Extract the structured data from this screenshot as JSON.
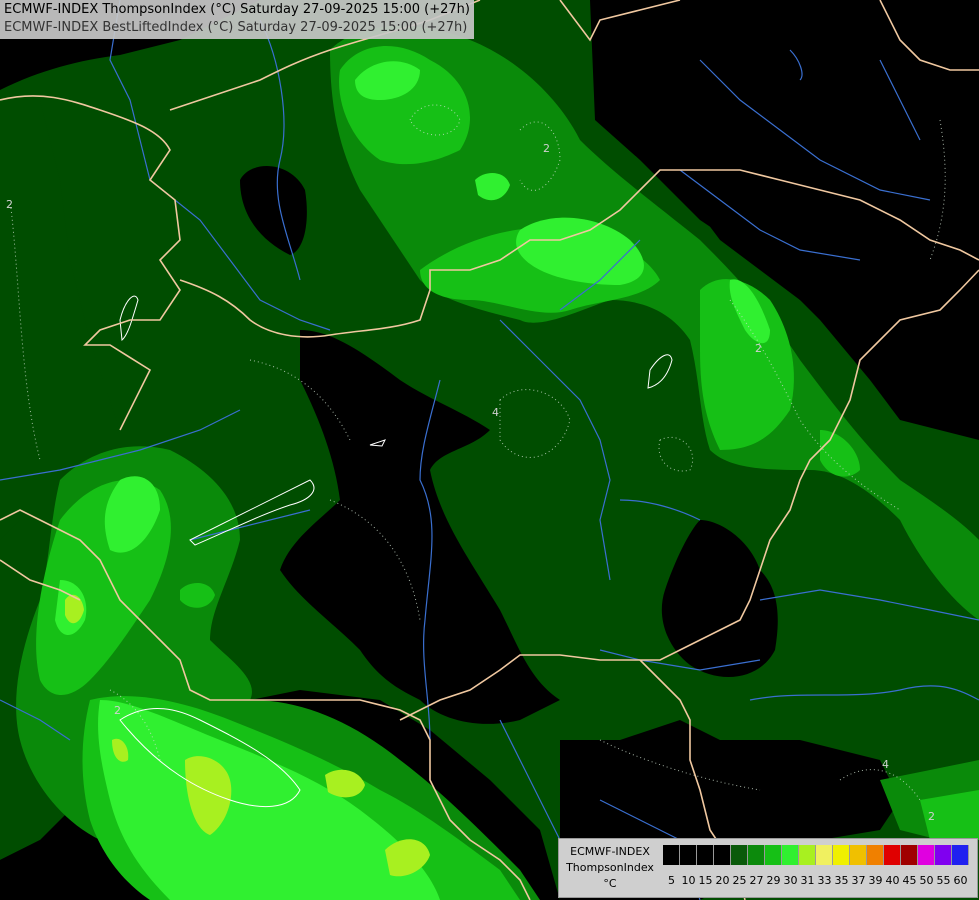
{
  "header": {
    "line1": "ECMWF-INDEX ThompsonIndex (°C) Saturday 27-09-2025 15:00 (+27h)",
    "line2": "ECMWF-INDEX BestLiftedIndex (°C) Saturday 27-09-2025 15:00 (+27h)"
  },
  "legend": {
    "line1": "ECMWF-INDEX",
    "line2": "ThompsonIndex",
    "line3": "°C",
    "ticks": [
      "5",
      "10",
      "15",
      "20",
      "25",
      "27",
      "29",
      "30",
      "31",
      "33",
      "35",
      "37",
      "39",
      "40",
      "45",
      "50",
      "55",
      "60"
    ],
    "colors": [
      "#000000",
      "#000000",
      "#000000",
      "#000000",
      "#0a5a0a",
      "#0c8a0c",
      "#16c016",
      "#30f030",
      "#a8f020",
      "#f0f060",
      "#f0f000",
      "#f0c000",
      "#f08000",
      "#e00000",
      "#a00000",
      "#e000e0",
      "#8000f0",
      "#2020f0"
    ]
  },
  "contour_labels": [
    "2",
    "2",
    "2",
    "4",
    "2",
    "4",
    "2"
  ],
  "colors": {
    "dark_green": "#004d00",
    "mid_green": "#0a8a0a",
    "bright_green": "#16c016",
    "lime": "#30f030",
    "yellow_green": "#a8f020",
    "border": "#f0c8a0",
    "river": "#3a6fd0"
  }
}
